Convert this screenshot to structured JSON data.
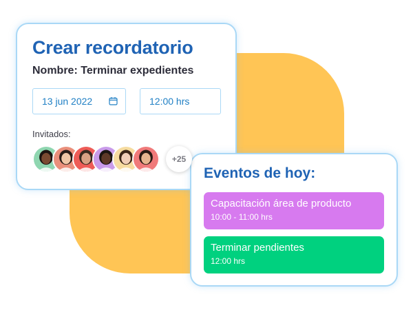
{
  "colors": {
    "background_shape": "#ffc555",
    "card_border": "#a9d8f6",
    "title_blue": "#1f63b4",
    "field_text": "#1f7fc4",
    "event_purple": "#d77aef",
    "event_green": "#00d17f"
  },
  "reminder": {
    "title": "Crear recordatorio",
    "name_line": "Nombre: Terminar expedientes",
    "date_value": "13 jun 2022",
    "date_icon": "calendar-icon",
    "time_value": "12:00 hrs",
    "guests_label": "Invitados:",
    "guests": [
      {
        "name": "guest-avatar-1",
        "bg": "#8fd6b0",
        "skin": "#7a4a32",
        "hair": "#1d1411"
      },
      {
        "name": "guest-avatar-2",
        "bg": "#ea8f7b",
        "skin": "#f0c6a6",
        "hair": "#2a1d18"
      },
      {
        "name": "guest-avatar-3",
        "bg": "#ee5c57",
        "skin": "#d8a184",
        "hair": "#3a2a20"
      },
      {
        "name": "guest-avatar-4",
        "bg": "#c99bea",
        "skin": "#5d3928",
        "hair": "#1a1412"
      },
      {
        "name": "guest-avatar-5",
        "bg": "#f6dca0",
        "skin": "#f1cfb8",
        "hair": "#3b2618"
      },
      {
        "name": "guest-avatar-6",
        "bg": "#f07a7a",
        "skin": "#e7b58f",
        "hair": "#2a1a14"
      }
    ],
    "more_guests": "+25"
  },
  "events": {
    "title": "Eventos de hoy:",
    "items": [
      {
        "title": "Capacitación área de producto",
        "time": "10:00 - 11:00 hrs",
        "color": "#d77aef"
      },
      {
        "title": "Terminar pendientes",
        "time": "12:00 hrs",
        "color": "#00d17f"
      }
    ]
  }
}
